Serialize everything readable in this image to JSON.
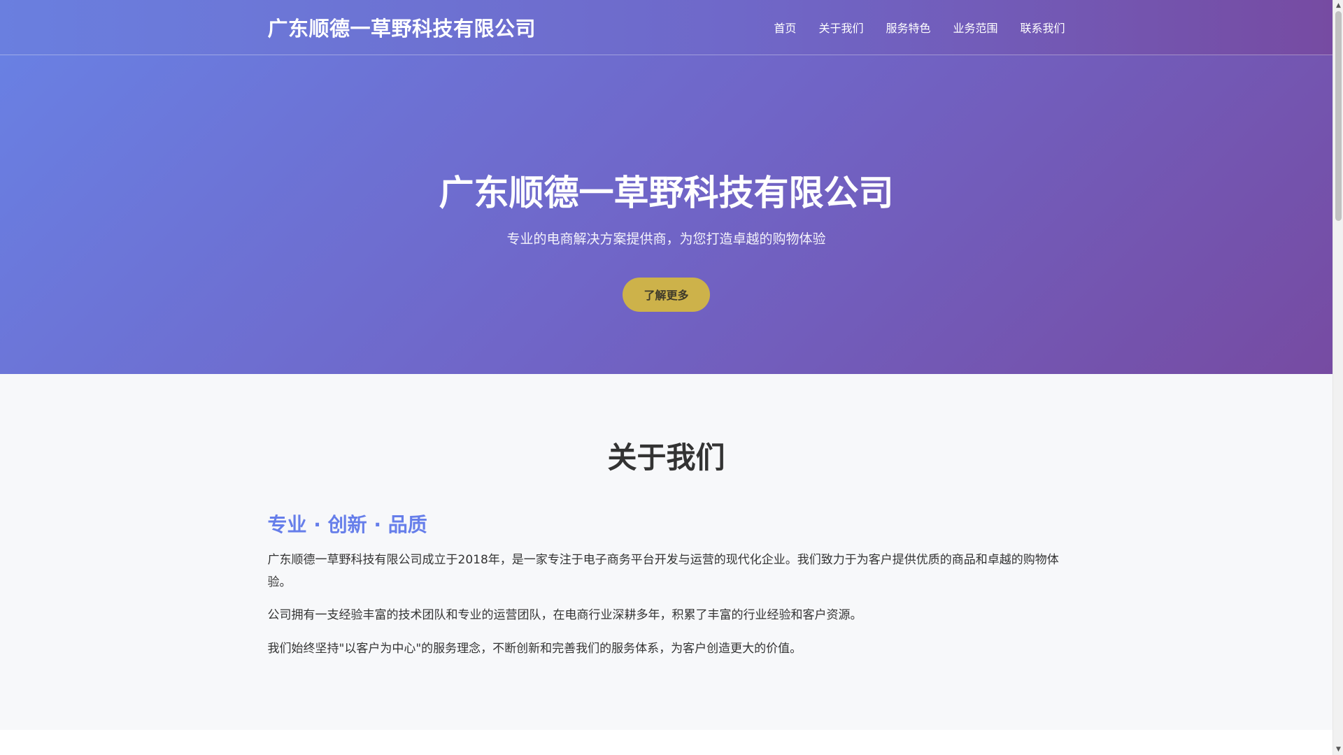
{
  "header": {
    "logo": "广东顺德一草野科技有限公司",
    "nav": [
      "首页",
      "关于我们",
      "服务特色",
      "业务范围",
      "联系我们"
    ]
  },
  "hero": {
    "title": "广东顺德一草野科技有限公司",
    "subtitle": "专业的电商解决方案提供商，为您打造卓越的购物体验",
    "button_label": "了解更多"
  },
  "about": {
    "title": "关于我们",
    "subtitle": "专业 · 创新 · 品质",
    "paragraphs": [
      "广东顺德一草野科技有限公司成立于2018年，是一家专注于电子商务平台开发与运营的现代化企业。我们致力于为客户提供优质的商品和卓越的购物体验。",
      "公司拥有一支经验丰富的技术团队和专业的运营团队，在电商行业深耕多年，积累了丰富的行业经验和客户资源。",
      "我们始终坚持\"以客户为中心\"的服务理念，不断创新和完善我们的服务体系，为客户创造更大的价值。"
    ]
  },
  "colors": {
    "gradient_start": "#667eea",
    "gradient_end": "#764ba2",
    "button": "#cdb24a",
    "accent_text": "#667eea"
  },
  "icons": {
    "scroll_up": "▲",
    "scroll_down": "▼"
  }
}
